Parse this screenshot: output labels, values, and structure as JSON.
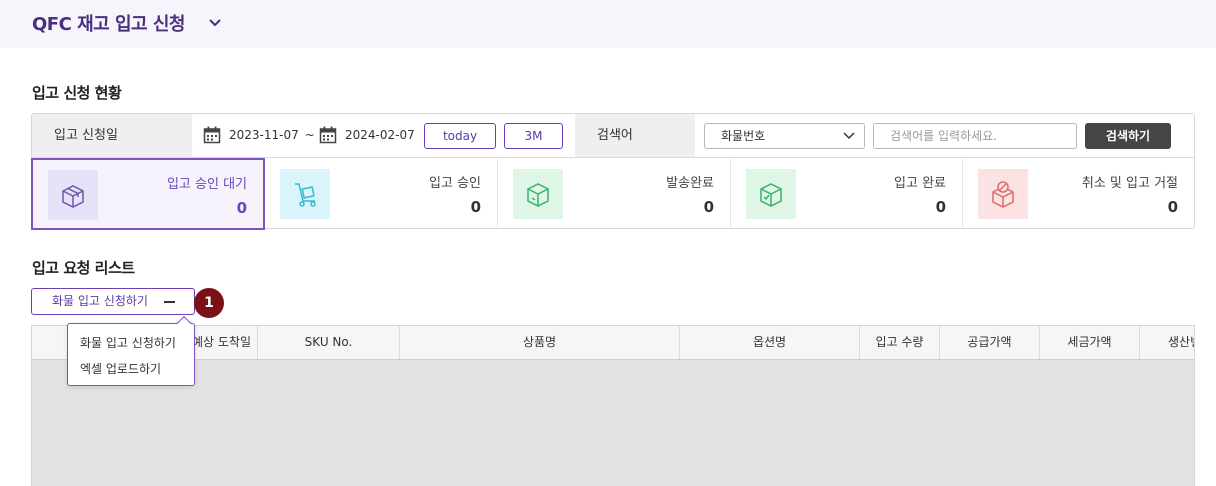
{
  "header": {
    "title": "QFC 재고 입고 신청",
    "chevron_icon": "chevron-down-icon"
  },
  "status_section": {
    "title": "입고 신청 현황"
  },
  "filters": {
    "date_label": "입고 신청일",
    "start_date": "2023-11-07",
    "separator": "~",
    "end_date": "2024-02-07",
    "today_label": "today",
    "range_3m_label": "3M",
    "search_label": "검색어",
    "search_type_selected": "화물번호",
    "search_placeholder": "검색어를 입력하세요.",
    "search_button": "검색하기"
  },
  "status_cards": [
    {
      "label": "입고 승인 대기",
      "count": "0",
      "icon": "package-box-icon",
      "color": "#e7e2f7",
      "active": true
    },
    {
      "label": "입고 승인",
      "count": "0",
      "icon": "hand-truck-icon",
      "color": "#d9f5fb",
      "active": false
    },
    {
      "label": "발송완료",
      "count": "0",
      "icon": "package-shipped-icon",
      "color": "#dff5e6",
      "active": false
    },
    {
      "label": "입고 완료",
      "count": "0",
      "icon": "package-complete-icon",
      "color": "#dff5e6",
      "active": false
    },
    {
      "label": "취소 및 입고 거절",
      "count": "0",
      "icon": "package-cancel-icon",
      "color": "#fbe3e3",
      "active": false
    }
  ],
  "request_section": {
    "title": "입고 요청 리스트",
    "add_button": "화물 입고 신청하기",
    "badge": "1",
    "menu_items": [
      "화물 입고 신청하기",
      "엑셀 업로드하기"
    ]
  },
  "table": {
    "columns": [
      "",
      "예상 도착일",
      "SKU No.",
      "상품명",
      "옵션명",
      "입고 수량",
      "공급가액",
      "세금가액",
      "생산번"
    ]
  },
  "colors": {
    "accent": "#6a3fb6",
    "badge": "#7a1116",
    "title": "#4b2f7e"
  }
}
